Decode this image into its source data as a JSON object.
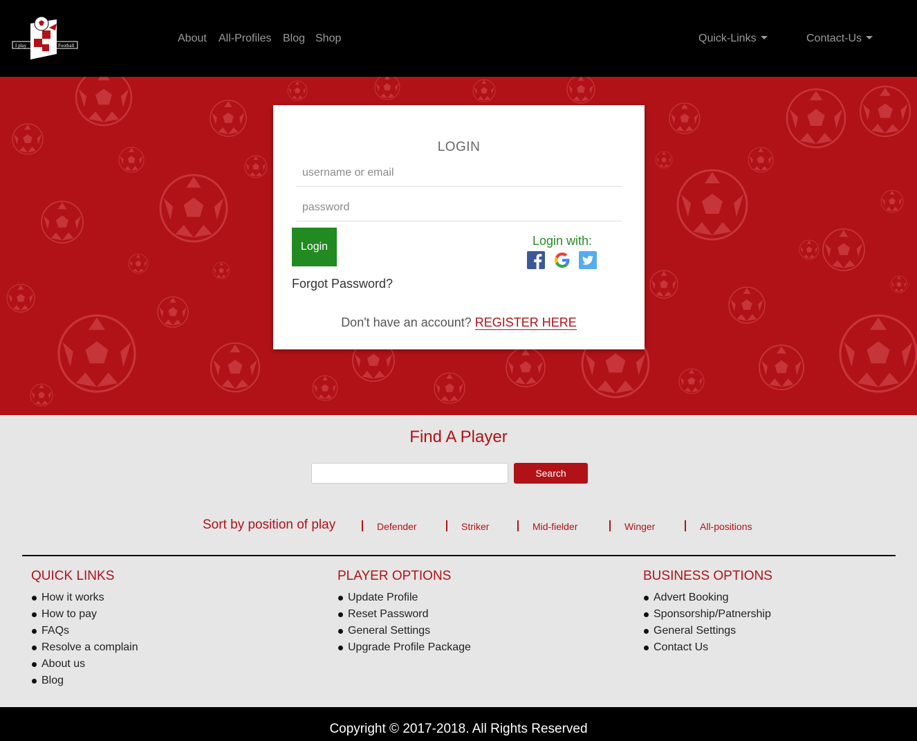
{
  "brand": {
    "logo_text_left": "I play",
    "logo_text_right": "Football",
    "colors": {
      "primary": "#b01217",
      "nav_bg": "#000000",
      "success": "#218a21",
      "page_bg": "#e6e6e6"
    }
  },
  "nav": {
    "links": [
      "About",
      "All-Profiles",
      "Blog",
      "Shop"
    ],
    "dropdowns": [
      "Quick-Links",
      "Contact-Us"
    ]
  },
  "login": {
    "title": "LOGIN",
    "username_placeholder": "username or email",
    "password_placeholder": "password",
    "button": "Login",
    "forgot": "Forgot Password?",
    "login_with": "Login with:",
    "social_icons": [
      "facebook-icon",
      "google-icon",
      "twitter-icon"
    ],
    "no_account": "Don't have an account?",
    "register": "REGISTER HERE"
  },
  "find_player": {
    "title": "Find A Player",
    "search_value": "",
    "search_button": "Search",
    "sort_label": "Sort by position of play",
    "positions": [
      "Defender",
      "Striker",
      "Mid-fielder",
      "Winger",
      "All-positions"
    ]
  },
  "footer": {
    "columns": [
      {
        "heading": "QUICK LINKS",
        "items": [
          "How it works",
          "How to pay",
          "FAQs",
          "Resolve a complain",
          "About us",
          "Blog"
        ]
      },
      {
        "heading": "PLAYER OPTIONS",
        "items": [
          "Update Profile",
          "Reset Password",
          "General Settings",
          "Upgrade Profile Package"
        ]
      },
      {
        "heading": "BUSINESS OPTIONS",
        "items": [
          "Advert Booking",
          "Sponsorship/Patnership",
          "General Settings",
          "Contact Us"
        ]
      }
    ],
    "copyright": "Copyright © 2017-2018. All Rights Reserved"
  }
}
